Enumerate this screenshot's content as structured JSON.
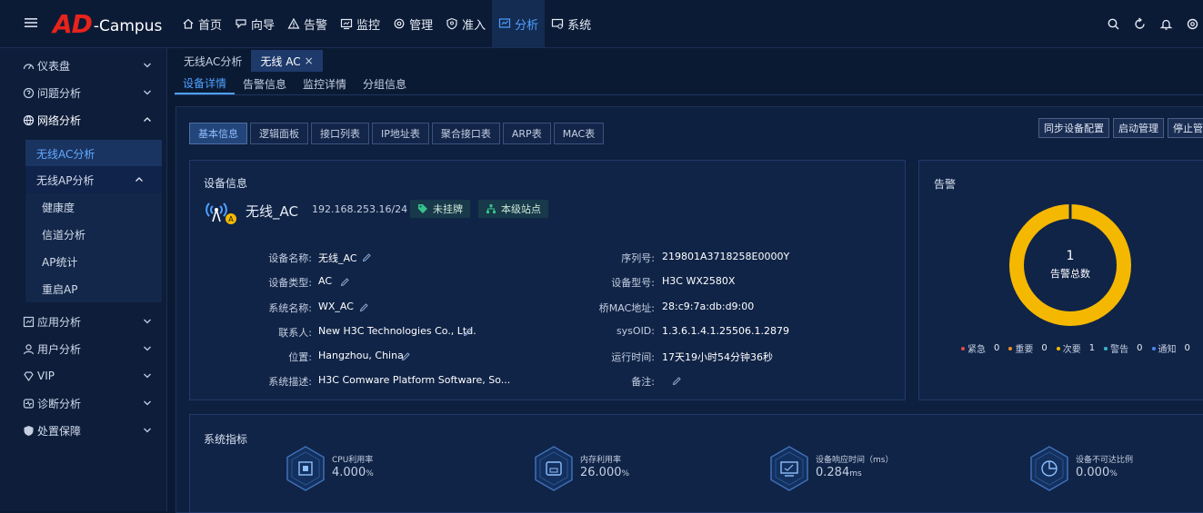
{
  "app": {
    "logo_ad": "AD",
    "logo_campus": "-Campus"
  },
  "nav": [
    {
      "label": "首页"
    },
    {
      "label": "向导"
    },
    {
      "label": "告警"
    },
    {
      "label": "监控"
    },
    {
      "label": "管理"
    },
    {
      "label": "准入"
    },
    {
      "label": "分析"
    },
    {
      "label": "系统"
    }
  ],
  "sidebar": {
    "items": [
      {
        "label": "仪表盘"
      },
      {
        "label": "问题分析"
      },
      {
        "label": "网络分析"
      },
      {
        "label": "应用分析"
      },
      {
        "label": "用户分析"
      },
      {
        "label": "VIP"
      },
      {
        "label": "诊断分析"
      },
      {
        "label": "处置保障"
      }
    ],
    "sub": [
      {
        "label": "无线AC分析"
      },
      {
        "label": "无线AP分析"
      }
    ],
    "sub3": [
      {
        "label": "健康度"
      },
      {
        "label": "信道分析"
      },
      {
        "label": "AP统计"
      },
      {
        "label": "重启AP"
      }
    ]
  },
  "tabs1": [
    {
      "label": "无线AC分析"
    },
    {
      "label": "无线 AC"
    }
  ],
  "tab_close": "×",
  "tabs2": [
    {
      "label": "设备详情"
    },
    {
      "label": "告警信息"
    },
    {
      "label": "监控详情"
    },
    {
      "label": "分组信息"
    }
  ],
  "btabs": [
    {
      "label": "基本信息"
    },
    {
      "label": "逻辑面板"
    },
    {
      "label": "接口列表"
    },
    {
      "label": "IP地址表"
    },
    {
      "label": "聚合接口表"
    },
    {
      "label": "ARP表"
    },
    {
      "label": "MAC表"
    }
  ],
  "actions": [
    {
      "label": "同步设备配置"
    },
    {
      "label": "启动管理"
    },
    {
      "label": "停止管"
    }
  ],
  "device": {
    "section_title": "设备信息",
    "name": "无线_AC",
    "ip": "192.168.253.16/24",
    "tag1": "未挂牌",
    "tag2": "本级站点",
    "left_fields": [
      {
        "label": "设备名称:",
        "value": "无线_AC"
      },
      {
        "label": "设备类型:",
        "value": "AC"
      },
      {
        "label": "系统名称:",
        "value": "WX_AC"
      },
      {
        "label": "联系人:",
        "value": "New H3C Technologies Co., Ltd."
      },
      {
        "label": "位置:",
        "value": "Hangzhou, China"
      },
      {
        "label": "系统描述:",
        "value": "H3C Comware Platform Software, So..."
      }
    ],
    "right_fields": [
      {
        "label": "序列号:",
        "value": "219801A3718258E0000Y"
      },
      {
        "label": "设备型号:",
        "value": "H3C WX2580X"
      },
      {
        "label": "桥MAC地址:",
        "value": "28:c9:7a:db:d9:00"
      },
      {
        "label": "sysOID:",
        "value": "1.3.6.1.4.1.25506.1.2879"
      },
      {
        "label": "运行时间:",
        "value": "17天19小时54分钟36秒"
      },
      {
        "label": "备注:",
        "value": ""
      }
    ]
  },
  "alarm": {
    "title": "告警",
    "total": "1",
    "total_label": "告警总数",
    "ring_color": "#f5b800",
    "legend": [
      {
        "label": "紧急",
        "value": "0",
        "color": "#e5484d"
      },
      {
        "label": "重要",
        "value": "0",
        "color": "#f08c2a"
      },
      {
        "label": "次要",
        "value": "1",
        "color": "#f5b800"
      },
      {
        "label": "警告",
        "value": "0",
        "color": "#3bb4c9"
      },
      {
        "label": "通知",
        "value": "0",
        "color": "#4e86f5"
      }
    ]
  },
  "metrics": {
    "title": "系统指标",
    "items": [
      {
        "label": "CPU利用率",
        "value": "4.000",
        "unit": "%"
      },
      {
        "label": "内存利用率",
        "value": "26.000",
        "unit": "%"
      },
      {
        "label": "设备响应时间（ms）",
        "value": "0.284",
        "unit": "ms"
      },
      {
        "label": "设备不可达比例",
        "value": "0.000",
        "unit": "%"
      }
    ]
  }
}
